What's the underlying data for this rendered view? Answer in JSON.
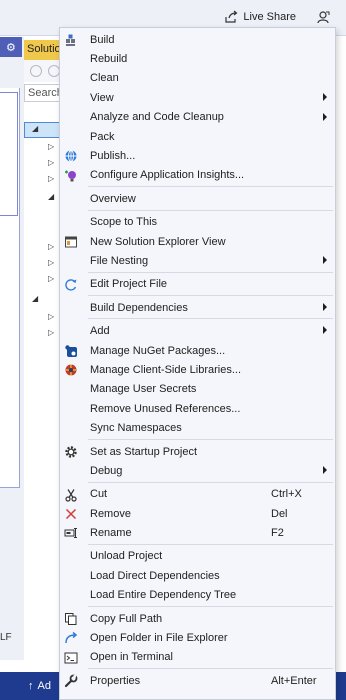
{
  "header": {
    "live_share_label": "Live Share",
    "live_share_icon": "live-share-icon",
    "feedback_icon": "feedback-icon"
  },
  "solution_explorer": {
    "title": "Solutio",
    "search_placeholder": "Search"
  },
  "editor": {
    "line_ending": "LF"
  },
  "status_bar": {
    "add_label": "Ad"
  },
  "menu": {
    "items": [
      {
        "label": "Build",
        "icon": "build-icon"
      },
      {
        "label": "Rebuild"
      },
      {
        "label": "Clean"
      },
      {
        "label": "View",
        "submenu": true
      },
      {
        "label": "Analyze and Code Cleanup",
        "submenu": true
      },
      {
        "label": "Pack"
      },
      {
        "label": "Publish...",
        "icon": "publish-globe-icon"
      },
      {
        "label": "Configure Application Insights...",
        "icon": "app-insights-icon"
      },
      {
        "separator": true
      },
      {
        "label": "Overview"
      },
      {
        "separator": true
      },
      {
        "label": "Scope to This"
      },
      {
        "label": "New Solution Explorer View",
        "icon": "new-view-icon"
      },
      {
        "label": "File Nesting",
        "submenu": true
      },
      {
        "separator": true
      },
      {
        "label": "Edit Project File",
        "icon": "edit-project-icon"
      },
      {
        "separator": true
      },
      {
        "label": "Build Dependencies",
        "submenu": true
      },
      {
        "separator": true
      },
      {
        "label": "Add",
        "submenu": true
      },
      {
        "label": "Manage NuGet Packages...",
        "icon": "nuget-icon"
      },
      {
        "label": "Manage Client-Side Libraries...",
        "icon": "client-libraries-icon"
      },
      {
        "label": "Manage User Secrets"
      },
      {
        "label": "Remove Unused References..."
      },
      {
        "label": "Sync Namespaces"
      },
      {
        "separator": true
      },
      {
        "label": "Set as Startup Project",
        "icon": "gear-icon"
      },
      {
        "label": "Debug",
        "submenu": true
      },
      {
        "separator": true
      },
      {
        "label": "Cut",
        "icon": "scissors-icon",
        "shortcut": "Ctrl+X"
      },
      {
        "label": "Remove",
        "icon": "remove-x-icon",
        "shortcut": "Del"
      },
      {
        "label": "Rename",
        "icon": "rename-icon",
        "shortcut": "F2"
      },
      {
        "separator": true
      },
      {
        "label": "Unload Project"
      },
      {
        "label": "Load Direct Dependencies"
      },
      {
        "label": "Load Entire Dependency Tree"
      },
      {
        "separator": true
      },
      {
        "label": "Copy Full Path",
        "icon": "copy-icon"
      },
      {
        "label": "Open Folder in File Explorer",
        "icon": "open-folder-arrow-icon"
      },
      {
        "label": "Open in Terminal",
        "icon": "terminal-icon"
      },
      {
        "separator": true
      },
      {
        "label": "Properties",
        "icon": "wrench-icon",
        "shortcut": "Alt+Enter"
      }
    ]
  }
}
